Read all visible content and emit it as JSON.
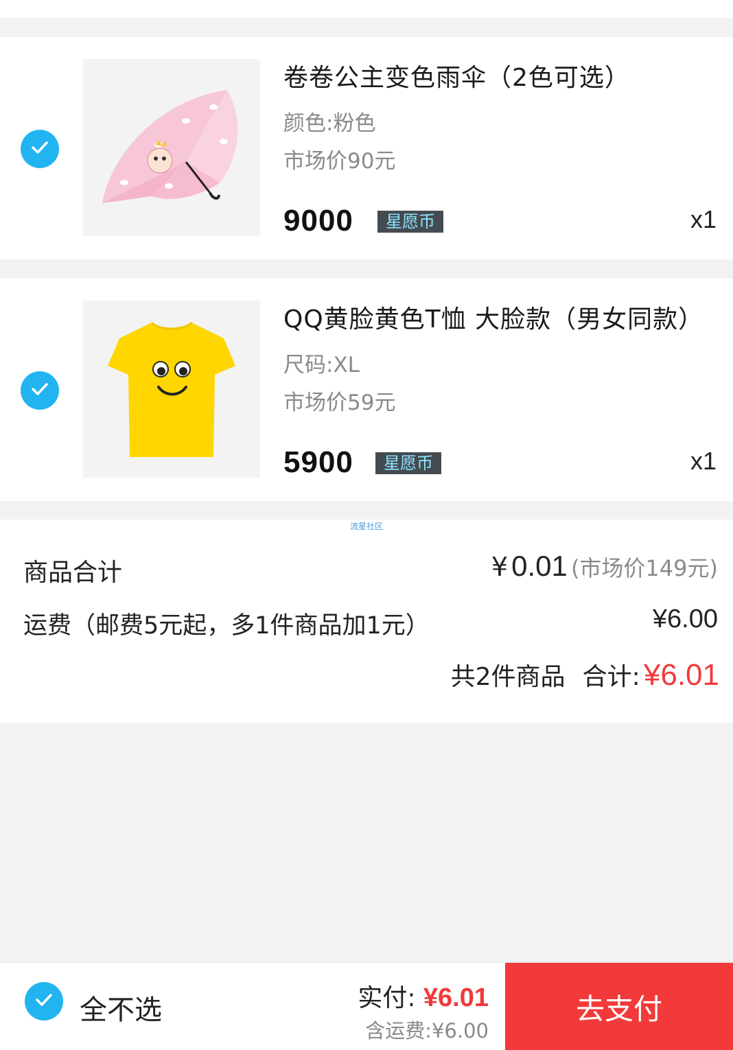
{
  "items": [
    {
      "title": "卷卷公主变色雨伞（2色可选）",
      "spec": "颜色:粉色",
      "market_price": "市场价90元",
      "price": "9000",
      "currency": "星愿币",
      "qty": "x1",
      "checked": true
    },
    {
      "title": "QQ黄脸黄色T恤 大脸款（男女同款）",
      "spec": "尺码:XL",
      "market_price": "市场价59元",
      "price": "5900",
      "currency": "星愿币",
      "qty": "x1",
      "checked": true
    }
  ],
  "summary": {
    "watermark": "流星社区",
    "goods_label": "商品合计",
    "goods_currency": "¥",
    "goods_amount": "0.01",
    "goods_market": "(市场价149元)",
    "shipping_label": "运费（邮费5元起，多1件商品加1元）",
    "shipping_value": "¥6.00",
    "count_text": "共2件商品",
    "total_label": "合计:",
    "total_value": "¥6.01"
  },
  "footer": {
    "select_all_label": "全不选",
    "pay_label": "实付:",
    "pay_amount": "¥6.01",
    "shipping_note": "含运费:¥6.00",
    "pay_button": "去支付"
  },
  "colors": {
    "accent_blue": "#21b4f0",
    "price_red": "#f03a3a",
    "pay_button_red": "#f23a3a",
    "coin_badge_bg": "#444b51"
  }
}
